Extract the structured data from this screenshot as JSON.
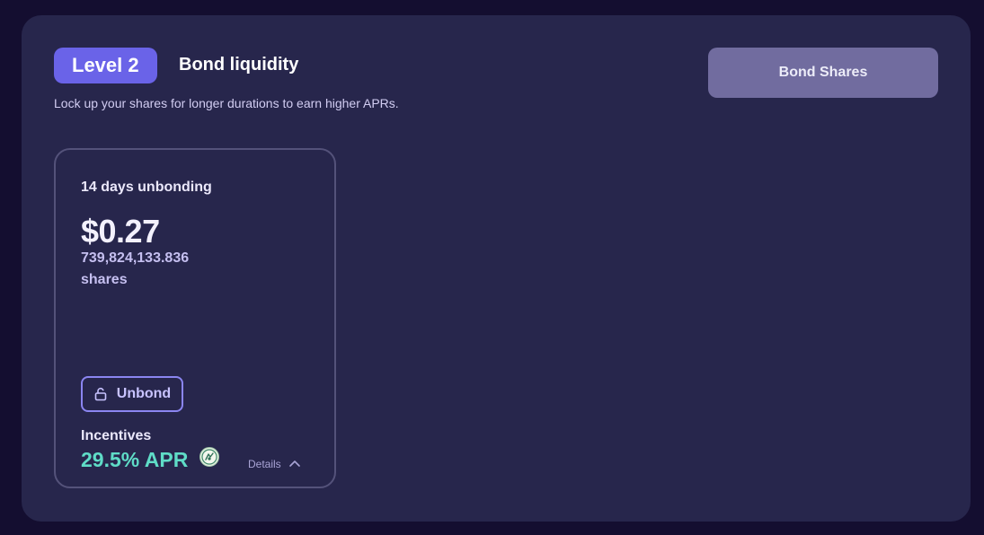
{
  "header": {
    "level_badge": "Level 2",
    "title": "Bond liquidity",
    "subtitle": "Lock up your shares for longer durations to earn higher APRs.",
    "bond_button": "Bond Shares"
  },
  "bond_card": {
    "duration": "14 days unbonding",
    "value": "$0.27",
    "shares_amount": "739,824,133.836",
    "shares_label": "shares",
    "unbond_button": "Unbond",
    "incentives_label": "Incentives",
    "apr": "29.5% APR",
    "details_label": "Details",
    "icons": {
      "unbond": "unlock-icon",
      "token": "incentive-token-icon",
      "details": "chevron-up-icon"
    }
  },
  "colors": {
    "page_bg": "#140e30",
    "panel_bg": "#27264c",
    "accent": "#6a63e8",
    "apr": "#5fdcc7",
    "bond_button_bg": "#716c9f"
  }
}
